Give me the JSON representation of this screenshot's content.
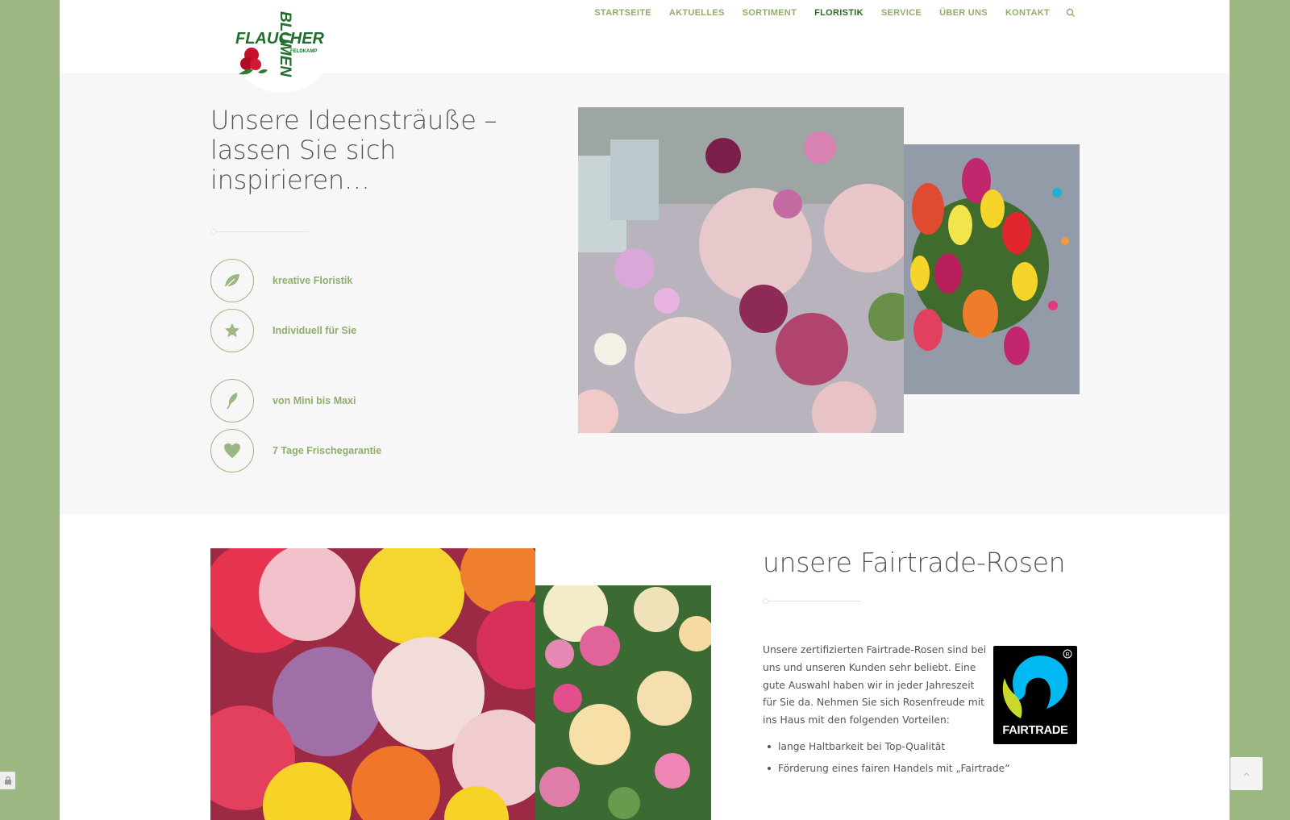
{
  "header": {
    "logo": {
      "brand": "FLAUCHER",
      "vertical": "BLUMEN",
      "sub": "FELDKAMP"
    },
    "nav": [
      {
        "label": "STARTSEITE",
        "active": false
      },
      {
        "label": "AKTUELLES",
        "active": false
      },
      {
        "label": "SORTIMENT",
        "active": false
      },
      {
        "label": "FLORISTIK",
        "active": true
      },
      {
        "label": "SERVICE",
        "active": false
      },
      {
        "label": "ÜBER UNS",
        "active": false
      },
      {
        "label": "KONTAKT",
        "active": false
      }
    ],
    "search_icon": "search-icon"
  },
  "section1": {
    "heading": "Unsere Ideensträuße – lassen Sie sich inspirieren…",
    "features": [
      {
        "icon": "leaf-icon",
        "label": "kreative Floristik"
      },
      {
        "icon": "star-icon",
        "label": "Individuell für Sie"
      },
      {
        "icon": "feather-icon",
        "label": "von Mini bis Maxi"
      },
      {
        "icon": "heart-icon",
        "label": "7 Tage Frischegarantie"
      }
    ]
  },
  "section2": {
    "heading": "unsere Fairtrade-Rosen",
    "paragraph": "Unsere zertifizierten Fairtrade-Rosen sind bei uns und unseren Kunden sehr beliebt. Eine gute Auswahl haben wir in jeder Jahreszeit für Sie da. Nehmen Sie sich Rosenfreude mit ins Haus mit den folgenden Vorteilen:",
    "bullets": [
      "lange Haltbarkeit bei Top-Qualität",
      "Förderung eines fairen Handels mit „Fairtrade“"
    ],
    "fairtrade_label": "FAIRTRADE"
  },
  "colors": {
    "accent": "#8fae6b",
    "active": "#2f6b22",
    "background": "#9db782"
  }
}
